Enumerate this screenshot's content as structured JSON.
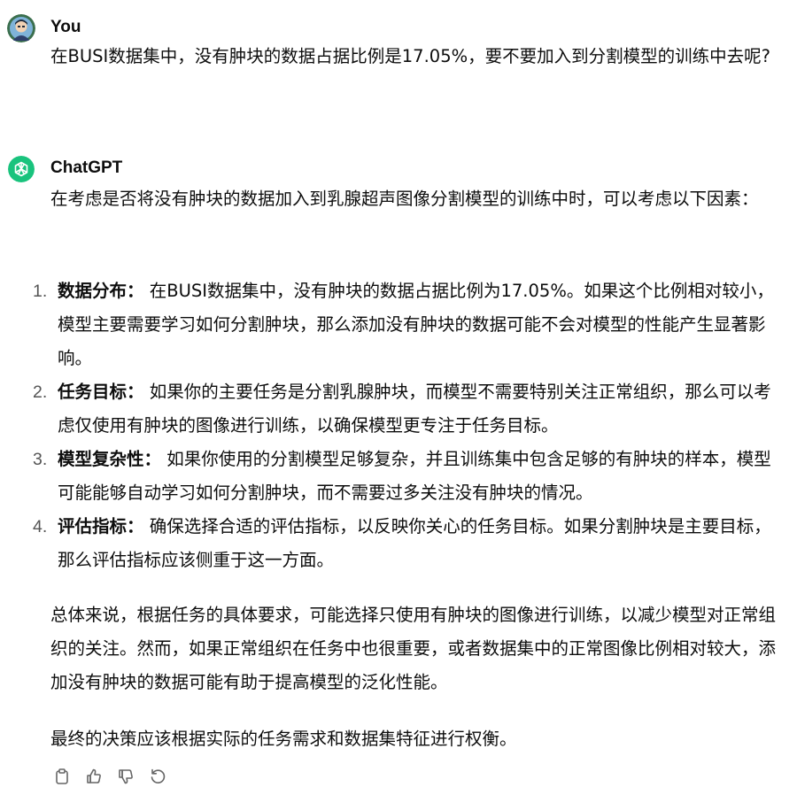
{
  "user_message": {
    "author": "You",
    "text": "在BUSI数据集中，没有肿块的数据占据比例是17.05%，要不要加入到分割模型的训练中去呢?"
  },
  "assistant_message": {
    "author": "ChatGPT",
    "intro": "在考虑是否将没有肿块的数据加入到乳腺超声图像分割模型的训练中时，可以考虑以下因素：",
    "items": [
      {
        "num": "1.",
        "title": "数据分布：",
        "body": "在BUSI数据集中，没有肿块的数据占据比例为17.05%。如果这个比例相对较小，模型主要需要学习如何分割肿块，那么添加没有肿块的数据可能不会对模型的性能产生显著影响。"
      },
      {
        "num": "2.",
        "title": "任务目标：",
        "body": "如果你的主要任务是分割乳腺肿块，而模型不需要特别关注正常组织，那么可以考虑仅使用有肿块的图像进行训练，以确保模型更专注于任务目标。"
      },
      {
        "num": "3.",
        "title": "模型复杂性：",
        "body": "如果你使用的分割模型足够复杂，并且训练集中包含足够的有肿块的样本，模型可能能够自动学习如何分割肿块，而不需要过多关注没有肿块的情况。"
      },
      {
        "num": "4.",
        "title": "评估指标：",
        "body": "确保选择合适的评估指标，以反映你关心的任务目标。如果分割肿块是主要目标，那么评估指标应该侧重于这一方面。"
      }
    ],
    "summary": "总体来说，根据任务的具体要求，可能选择只使用有肿块的图像进行训练，以减少模型对正常组织的关注。然而，如果正常组织在任务中也很重要，或者数据集中的正常图像比例相对较大，添加没有肿块的数据可能有助于提高模型的泛化性能。",
    "conclusion": "最终的决策应该根据实际的任务需求和数据集特征进行权衡。"
  },
  "actions": [
    {
      "icon": "copy-icon"
    },
    {
      "icon": "thumbs-up-icon"
    },
    {
      "icon": "thumbs-down-icon"
    },
    {
      "icon": "regenerate-icon"
    }
  ],
  "colors": {
    "chatgpt_brand": "#19c37d",
    "text": "#0d0d0d",
    "icon": "#666666"
  }
}
